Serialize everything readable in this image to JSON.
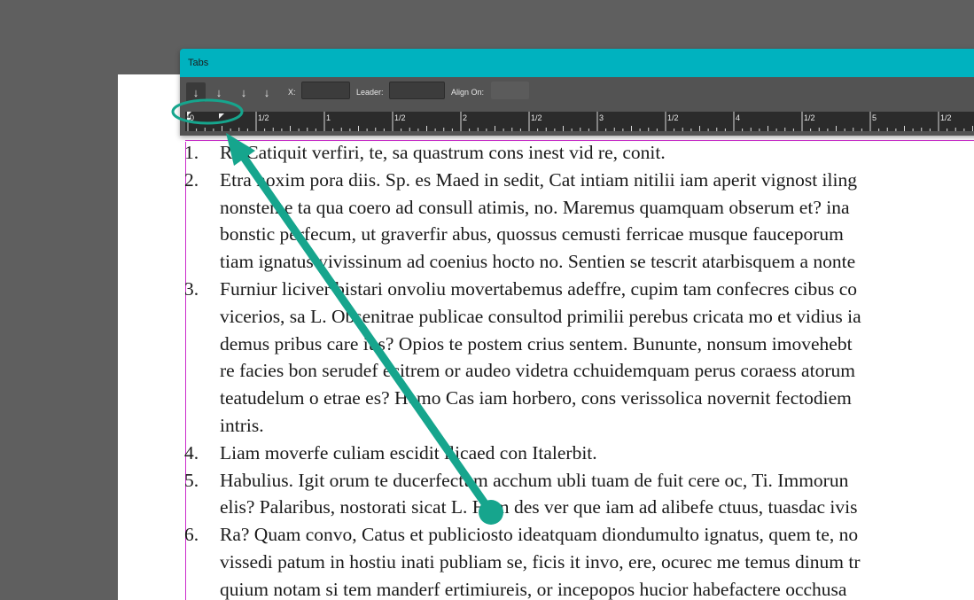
{
  "panel": {
    "title": "Tabs",
    "x_label": "X:",
    "x_value": "",
    "leader_label": "Leader:",
    "leader_value": "",
    "align_on_label": "Align On:",
    "align_on_value": "",
    "tab_buttons": [
      {
        "name": "left-justified-tab",
        "icon": "left-tab-icon",
        "glyph": "↓",
        "active": true
      },
      {
        "name": "center-justified-tab",
        "icon": "center-tab-icon",
        "glyph": "↓",
        "active": false
      },
      {
        "name": "right-justified-tab",
        "icon": "right-tab-icon",
        "glyph": "↓",
        "active": false
      },
      {
        "name": "align-to-decimal-tab",
        "icon": "decimal-tab-icon",
        "glyph": "↓",
        "active": false
      }
    ]
  },
  "ruler": {
    "labels": [
      "0",
      "1/2",
      "1",
      "1/2",
      "2",
      "1/2",
      "3",
      "1/2",
      "4",
      "1/2",
      "5",
      "1/2"
    ]
  },
  "document": {
    "items": [
      {
        "num": "1.",
        "lines": [
          "Ra Catiquit verfiri, te, sa quastrum cons inest vid re, conit."
        ]
      },
      {
        "num": "2.",
        "lines": [
          "Etra noxim pora diis. Sp. es Maed in sedit, Cat intiam nitilii iam aperit vignost iling",
          "nonsteme ta qua coero ad consull atimis, no. Maremus quamquam obserum et? ina",
          "bonstic perfecum, ut graverfir abus, quossus cemusti ferricae musque fauceporum",
          "tiam ignatus vivissinum ad coenius hocto no. Sentien se tescrit atarbisquem a nonte"
        ]
      },
      {
        "num": "3.",
        "lines": [
          "Furniur liciver bistari onvoliu movertabemus adeffre, cupim tam confecres cibus co",
          "vicerios, sa L. Obsenitrae publicae consultod primilii perebus cricata mo et vidius ia",
          "demus pribus care ius? Opios te postem crius sentem. Bununte, nonsum imovehebt",
          "re facies bon serudef ecitrem or audeo videtra cchuidemquam perus coraess atorum",
          "teatudelum o etrae es? Hemo Cas iam horbero, cons verissolica novernit fectodiem",
          "intris."
        ]
      },
      {
        "num": "4.",
        "lines": [
          "Liam moverfe culiam escidit ilicaed con Italerbit."
        ]
      },
      {
        "num": "5.",
        "lines": [
          "Habulius. Igit orum te ducerfectum acchum ubli tuam de fuit cere oc, Ti. Immorun",
          "elis? Palaribus, nostorati sicat L. Hem des ver que iam ad alibefe ctuus, tuasdac ivis"
        ]
      },
      {
        "num": "6.",
        "lines": [
          "Ra? Quam convo, Catus et publiciosto ideatquam diondumulto ignatus, quem te, no",
          "vissedi patum in hostiu inati publiam se, ficis it invo, ere, ocurec me temus dinum tr",
          "quium notam si tem manderf ertimiureis, or incepopos hucior habefactere occhusa"
        ]
      }
    ]
  },
  "colors": {
    "panel_title_bar": "#00b2bf",
    "panel_body": "#535353",
    "ruler_bg": "#2b2b2b",
    "annotation": "#16a58d",
    "margin_guide": "#cc2ccc"
  }
}
